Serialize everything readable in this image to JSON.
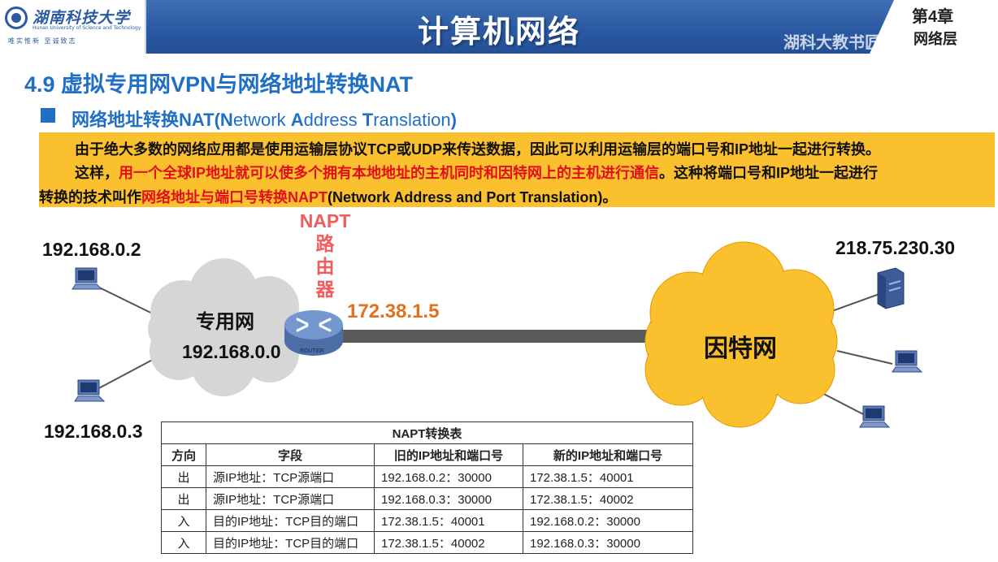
{
  "header": {
    "university_name": "湖南科技大学",
    "university_en": "Hunan University of Science and Technology",
    "motto": "唯实惟新 至诚致志",
    "course_title": "计算机网络",
    "chapter_number": "第4章",
    "chapter_name": "网络层",
    "watermark": "湖科大教书匠"
  },
  "section_title": "4.9 虚拟专用网VPN与网络地址转换NAT",
  "subsection": {
    "title_bold": "网络地址转换NAT(",
    "title_rest": [
      {
        "bold": "N",
        "text": "etwork "
      },
      {
        "bold": "A",
        "text": "ddress "
      },
      {
        "bold": "T",
        "text": "ranslation"
      },
      {
        "bold": ")",
        "text": ""
      }
    ]
  },
  "paragraph": {
    "line1": "由于绝大多数的网络应用都是使用运输层协议TCP或UDP来传送数据，因此可以利用运输层的端口号和IP地址一起进行转换。",
    "line2_a": "这样，",
    "line2_red": "用一个全球IP地址就可以使多个拥有本地地址的主机同时和因特网上的主机进行通信",
    "line2_b": "。这种将端口号和IP地址一起进行",
    "line3_a": "转换的技术叫作",
    "line3_red": "网络地址与端口号转换NAPT",
    "line3_b": "(Network Address and Port Translation)。"
  },
  "diagram": {
    "host1_ip": "192.168.0.2",
    "host2_ip": "192.168.0.3",
    "private_net_label": "专用网",
    "private_net_addr": "192.168.0.0",
    "router_title": [
      "NAPT",
      "路",
      "由",
      "器"
    ],
    "router_icon_label": "ROUTER",
    "router_public_ip": "172.38.1.5",
    "internet_label": "因特网",
    "server_ip": "218.75.230.30"
  },
  "table": {
    "caption": "NAPT转换表",
    "headers": [
      "方向",
      "字段",
      "旧的IP地址和端口号",
      "新的IP地址和端口号"
    ],
    "rows": [
      [
        "出",
        "源IP地址：TCP源端口",
        "192.168.0.2：30000",
        "172.38.1.5：40001"
      ],
      [
        "出",
        "源IP地址：TCP源端口",
        "192.168.0.3：30000",
        "172.38.1.5：40002"
      ],
      [
        "入",
        "目的IP地址：TCP目的端口",
        "172.38.1.5：40001",
        "192.168.0.2：30000"
      ],
      [
        "入",
        "目的IP地址：TCP目的端口",
        "172.38.1.5：40002",
        "192.168.0.3：30000"
      ]
    ]
  },
  "colors": {
    "header_blue": "#2b5aa3",
    "heading_blue": "#1f6fc5",
    "highlight_yellow": "#fbc02d",
    "emphasis_red": "#e0101a",
    "router_ip_orange": "#e3701d",
    "napt_label_red": "#f25c5c",
    "private_cloud_gray": "#d6d6d6",
    "internet_cloud_yellow": "#fbc02d"
  }
}
